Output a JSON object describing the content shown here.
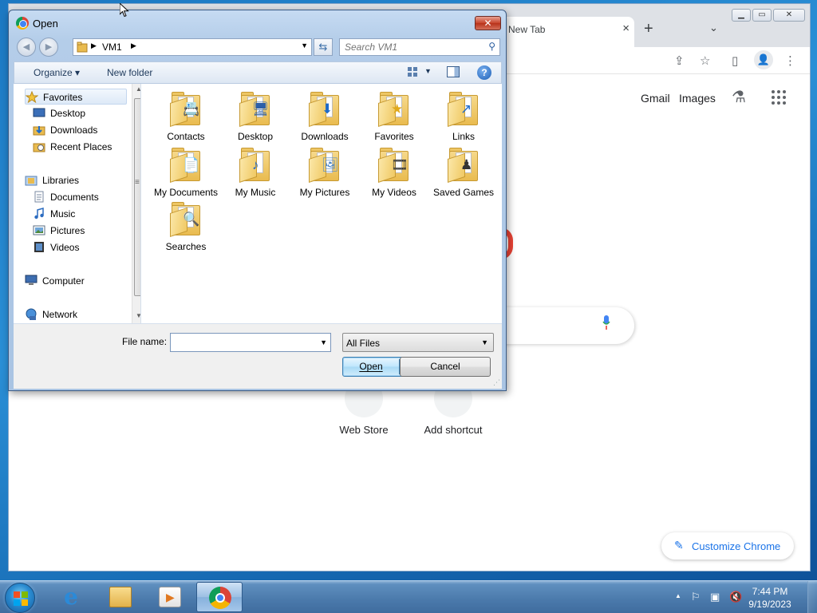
{
  "chrome_window": {
    "tab_title": "New Tab",
    "tab_close_icon": "×",
    "new_tab_icon": "+",
    "tab_search_icon": "⌄",
    "window_buttons": [
      "▁",
      "▭",
      "✕"
    ],
    "toolbar_icons": [
      "⇪",
      "☆",
      "▯",
      "⋮"
    ],
    "top_links": [
      "Gmail",
      "Images"
    ],
    "labs_icon": "⚗",
    "shortcuts": [
      {
        "label": "Web Store"
      },
      {
        "label": "Add shortcut"
      }
    ],
    "customize_label": "Customize Chrome",
    "customize_icon": "✎"
  },
  "dialog": {
    "title": "Open",
    "close_icon": "✕",
    "back_icon": "◀",
    "forward_icon": "▶",
    "breadcrumb": "VM1",
    "search_placeholder": "Search VM1",
    "search_icon": "⚲",
    "refresh_icon": "⇆",
    "toolbar": {
      "organize_label": "Organize ▾",
      "new_folder_label": "New folder",
      "help_icon": "?"
    },
    "nav_items": [
      {
        "label": "Favorites",
        "type": "header",
        "icon": "star-icon"
      },
      {
        "label": "Desktop",
        "type": "item",
        "icon": "desktop-icon"
      },
      {
        "label": "Downloads",
        "type": "item",
        "icon": "downloads-icon"
      },
      {
        "label": "Recent Places",
        "type": "item",
        "icon": "recent-places-icon"
      },
      {
        "label": "Libraries",
        "type": "header",
        "icon": "libraries-icon"
      },
      {
        "label": "Documents",
        "type": "item",
        "icon": "documents-icon"
      },
      {
        "label": "Music",
        "type": "item",
        "icon": "music-icon"
      },
      {
        "label": "Pictures",
        "type": "item",
        "icon": "pictures-icon"
      },
      {
        "label": "Videos",
        "type": "item",
        "icon": "videos-icon"
      },
      {
        "label": "Computer",
        "type": "header",
        "icon": "computer-icon"
      },
      {
        "label": "Network",
        "type": "header",
        "icon": "network-icon"
      }
    ],
    "folders": [
      {
        "label": "Contacts",
        "glyph": "📇"
      },
      {
        "label": "Desktop",
        "glyph": "🖥"
      },
      {
        "label": "Downloads",
        "glyph": "⬇"
      },
      {
        "label": "Favorites",
        "glyph": "★"
      },
      {
        "label": "Links",
        "glyph": "↗"
      },
      {
        "label": "My Documents",
        "glyph": "📄"
      },
      {
        "label": "My Music",
        "glyph": "♪"
      },
      {
        "label": "My Pictures",
        "glyph": "🖼"
      },
      {
        "label": "My Videos",
        "glyph": "🎞"
      },
      {
        "label": "Saved Games",
        "glyph": "♟"
      },
      {
        "label": "Searches",
        "glyph": "🔍"
      }
    ],
    "file_name_label": "File name:",
    "file_name_value": "",
    "file_type": "All Files",
    "open_label": "Open",
    "cancel_label": "Cancel"
  },
  "taskbar": {
    "clock_time": "7:44 PM",
    "clock_date": "9/19/2023",
    "tray_icons": [
      "⚐",
      "▣",
      "🔇"
    ],
    "tray_expand_icon": "▲",
    "ie_glyph": "e",
    "active_app": "chrome"
  },
  "colors": {
    "desktop_blue": "#1c78c2",
    "chrome_accent": "#1a73e8",
    "dialog_frame": "#b4cde9",
    "close_red": "#c7432b"
  }
}
